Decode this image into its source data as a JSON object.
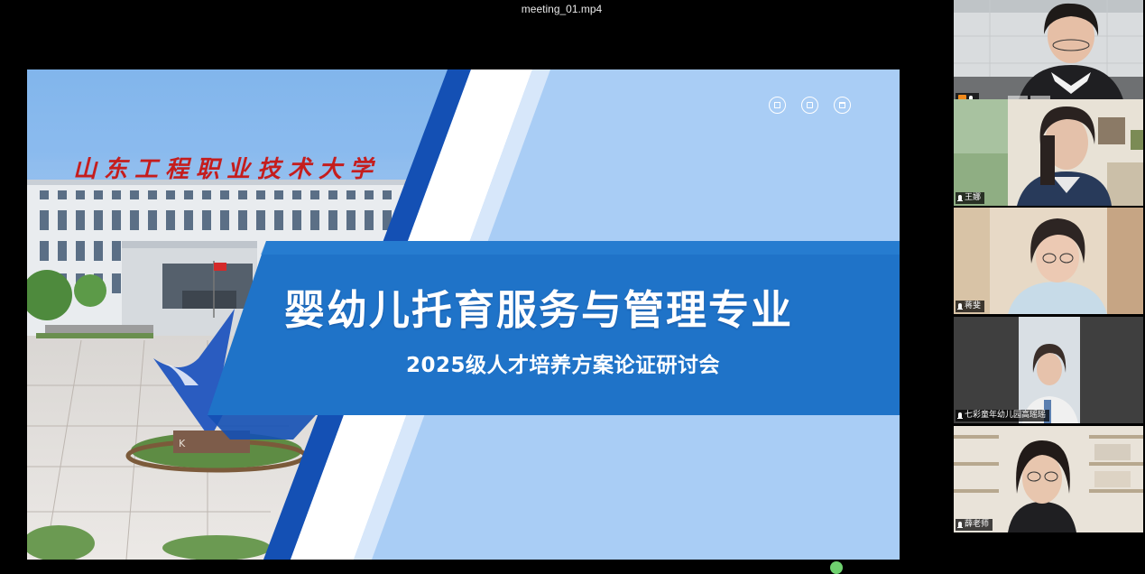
{
  "window": {
    "file_title": "meeting_01.mp4"
  },
  "slide": {
    "school_name": "山东工程职业技术大学",
    "title": "婴幼儿托育服务与管理专业",
    "subtitle": "2025级人才培养方案论证研讨会",
    "icons": [
      "chart-icon",
      "document-icon",
      "calendar-icon"
    ]
  },
  "participants": [
    {
      "name": "",
      "host": true,
      "mic": "mic-icon",
      "active": true
    },
    {
      "name": "王娜",
      "mic": "mic-icon"
    },
    {
      "name": "蒋斐",
      "mic": "mic-icon"
    },
    {
      "name": "七彩童年幼儿园高瑶瑶",
      "mic": "mic-icon"
    },
    {
      "name": "薛老师",
      "mic": "mic-icon"
    }
  ],
  "colors": {
    "slide_blue": "#1f73c8",
    "slide_dark_blue": "#1450b4",
    "slide_light_blue": "#a9cdf5",
    "school_red": "#c51d1d",
    "active_border": "#1e7bd6",
    "host_badge": "#f08a1c"
  }
}
